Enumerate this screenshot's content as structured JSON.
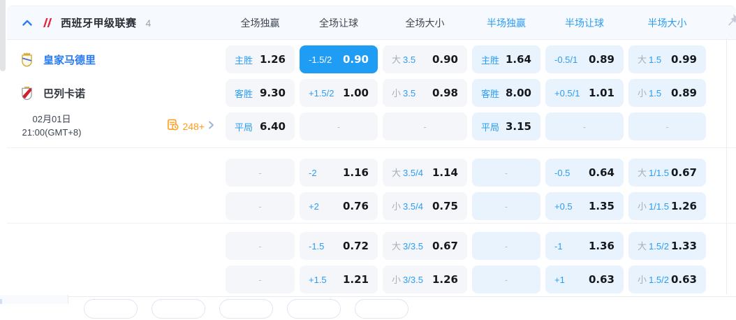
{
  "league_header": {
    "title": "西班牙甲级联赛",
    "count": "4",
    "columns": [
      {
        "label": "全场独赢",
        "active": false
      },
      {
        "label": "全场让球",
        "active": false
      },
      {
        "label": "全场大小",
        "active": false
      },
      {
        "label": "半场独赢",
        "active": true
      },
      {
        "label": "半场让球",
        "active": true
      },
      {
        "label": "半场大小",
        "active": true
      }
    ]
  },
  "match": {
    "home_team": "皇家马德里",
    "away_team": "巴列卡诺",
    "date": "02月01日",
    "time": "21:00(GMT+8)",
    "markets_count": "248+"
  },
  "empty_placeholder": "-",
  "odds_sections": [
    {
      "rows": [
        [
          {
            "t": "labeled",
            "label": "主胜",
            "value": "1.26"
          },
          {
            "t": "labeled",
            "label": "-1.5/2",
            "value": "0.90",
            "selected": true
          },
          {
            "t": "ou",
            "prefix": "大",
            "line": "3.5",
            "value": "0.90"
          },
          {
            "t": "labeled",
            "label": "主胜",
            "value": "1.64"
          },
          {
            "t": "labeled",
            "label": "-0.5/1",
            "value": "0.89"
          },
          {
            "t": "ou",
            "prefix": "大",
            "line": "1.5",
            "value": "0.99"
          }
        ],
        [
          {
            "t": "labeled",
            "label": "客胜",
            "value": "9.30"
          },
          {
            "t": "labeled",
            "label": "+1.5/2",
            "value": "1.00"
          },
          {
            "t": "ou",
            "prefix": "小",
            "line": "3.5",
            "value": "0.98"
          },
          {
            "t": "labeled",
            "label": "客胜",
            "value": "8.00"
          },
          {
            "t": "labeled",
            "label": "+0.5/1",
            "value": "1.01"
          },
          {
            "t": "ou",
            "prefix": "小",
            "line": "1.5",
            "value": "0.89"
          }
        ],
        [
          {
            "t": "labeled",
            "label": "平局",
            "value": "6.40"
          },
          {
            "t": "empty"
          },
          {
            "t": "empty"
          },
          {
            "t": "labeled",
            "label": "平局",
            "value": "3.15"
          },
          {
            "t": "empty"
          },
          {
            "t": "empty"
          }
        ]
      ]
    },
    {
      "rows": [
        [
          {
            "t": "empty"
          },
          {
            "t": "labeled",
            "label": "-2",
            "value": "1.16"
          },
          {
            "t": "ou",
            "prefix": "大",
            "line": "3.5/4",
            "value": "1.14"
          },
          {
            "t": "empty"
          },
          {
            "t": "labeled",
            "label": "-0.5",
            "value": "0.64"
          },
          {
            "t": "ou",
            "prefix": "大",
            "line": "1/1.5",
            "value": "0.67"
          }
        ],
        [
          {
            "t": "empty"
          },
          {
            "t": "labeled",
            "label": "+2",
            "value": "0.76"
          },
          {
            "t": "ou",
            "prefix": "小",
            "line": "3.5/4",
            "value": "0.75"
          },
          {
            "t": "empty"
          },
          {
            "t": "labeled",
            "label": "+0.5",
            "value": "1.35"
          },
          {
            "t": "ou",
            "prefix": "小",
            "line": "1/1.5",
            "value": "1.26"
          }
        ]
      ]
    },
    {
      "rows": [
        [
          {
            "t": "empty"
          },
          {
            "t": "labeled",
            "label": "-1.5",
            "value": "0.72"
          },
          {
            "t": "ou",
            "prefix": "大",
            "line": "3/3.5",
            "value": "0.67"
          },
          {
            "t": "empty"
          },
          {
            "t": "labeled",
            "label": "-1",
            "value": "1.36"
          },
          {
            "t": "ou",
            "prefix": "大",
            "line": "1.5/2",
            "value": "1.33"
          }
        ],
        [
          {
            "t": "empty"
          },
          {
            "t": "labeled",
            "label": "+1.5",
            "value": "1.21"
          },
          {
            "t": "ou",
            "prefix": "小",
            "line": "3/3.5",
            "value": "1.26"
          },
          {
            "t": "empty"
          },
          {
            "t": "labeled",
            "label": "+1",
            "value": "0.63"
          },
          {
            "t": "ou",
            "prefix": "小",
            "line": "1.5/2",
            "value": "0.63"
          }
        ]
      ]
    }
  ],
  "bottom_chips_count": 5,
  "icons": {
    "collapse": "chevron-up-icon",
    "league_logo": "laliga-logo",
    "markets": "markets-list-icon",
    "more": "chevron-right-icon",
    "pin": "pushpin-icon"
  },
  "colors": {
    "accent_blue": "#2b9df4",
    "selected_cell": "#1f9cf4",
    "home_team_blue": "#2679f0",
    "markets_orange": "#ff9d1f",
    "fulltime_cell_bg": "#f4f6fa",
    "halftime_cell_bg": "#e9f3fd",
    "header_bg": "#f6f9fd"
  }
}
